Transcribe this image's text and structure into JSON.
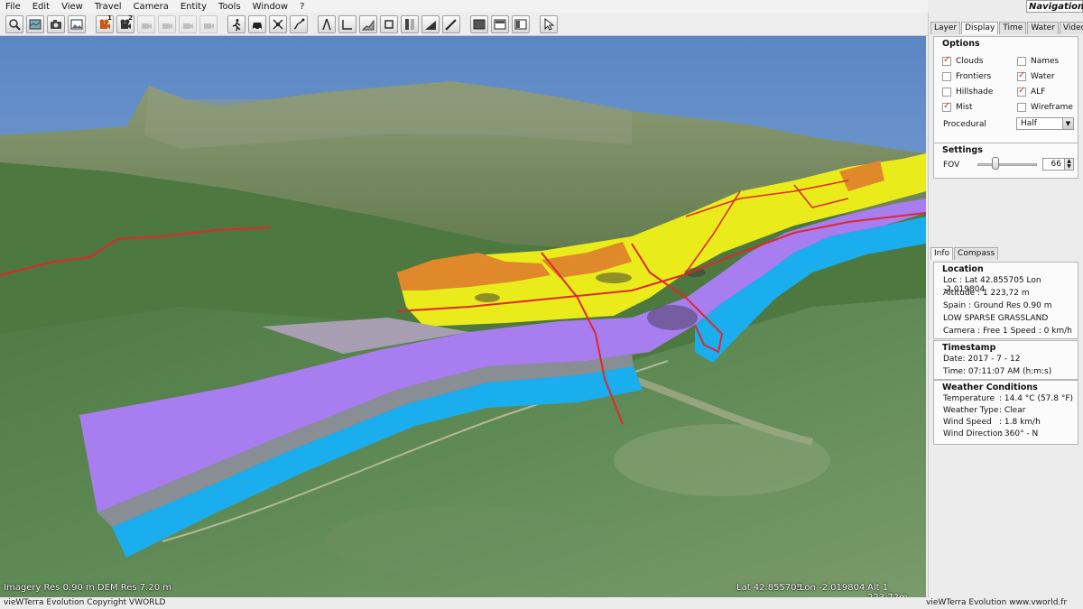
{
  "menu": [
    "File",
    "Edit",
    "View",
    "Travel",
    "Camera",
    "Entity",
    "Tools",
    "Window",
    "?"
  ],
  "nav_mode": "Navigation",
  "toolbar": {
    "camera1_badge": "1",
    "camera2_badge": "2"
  },
  "viewport_hud": {
    "resolution": "Imagery Res 0.90 m DEM Res 7.20 m",
    "lat": "Lat 42.855705",
    "lon": "Lon -2.019804",
    "alt": "Alt 1 223,72m"
  },
  "status": {
    "left": "vieWTerra Evolution Copyright VWORLD",
    "right": "vieWTerra Evolution www.vworld.fr"
  },
  "top_tabs": [
    "Layer",
    "Display",
    "Time",
    "Water",
    "Video"
  ],
  "options": {
    "title": "Options",
    "items": [
      {
        "label": "Clouds",
        "checked": true
      },
      {
        "label": "Names",
        "checked": false
      },
      {
        "label": "Frontiers",
        "checked": false
      },
      {
        "label": "Water",
        "checked": true
      },
      {
        "label": "Hillshade",
        "checked": false
      },
      {
        "label": "ALF",
        "checked": true
      },
      {
        "label": "Mist",
        "checked": true
      },
      {
        "label": "Wireframe",
        "checked": false
      }
    ],
    "procedural_label": "Procedural",
    "procedural_value": "Half"
  },
  "settings": {
    "title": "Settings",
    "fov_label": "FOV",
    "fov_value": "66",
    "fov_fraction": 0.3
  },
  "bottom_tabs": [
    "Info",
    "Compass"
  ],
  "location": {
    "title": "Location",
    "lines": [
      "Loc : Lat 42.855705 Lon -2.019804",
      "Altitude : 1 223,72 m",
      "Spain : Ground Res  0.90 m",
      "LOW SPARSE GRASSLAND",
      "Camera : Free 1     Speed : 0 km/h"
    ]
  },
  "timestamp": {
    "title": "Timestamp",
    "lines": [
      "Date: 2017 - 7 - 12",
      "Time: 07:11:07 AM    (h:m:s)"
    ]
  },
  "weather": {
    "title": "Weather Conditions",
    "rows": [
      {
        "k": "Temperature",
        "v": ": 14.4 °C (57.8 °F)"
      },
      {
        "k": "Weather Type",
        "v": ": Clear"
      },
      {
        "k": "Wind Speed",
        "v": ": 1.8 km/h"
      },
      {
        "k": "Wind Direction",
        "v": ": 360° - N"
      }
    ]
  }
}
